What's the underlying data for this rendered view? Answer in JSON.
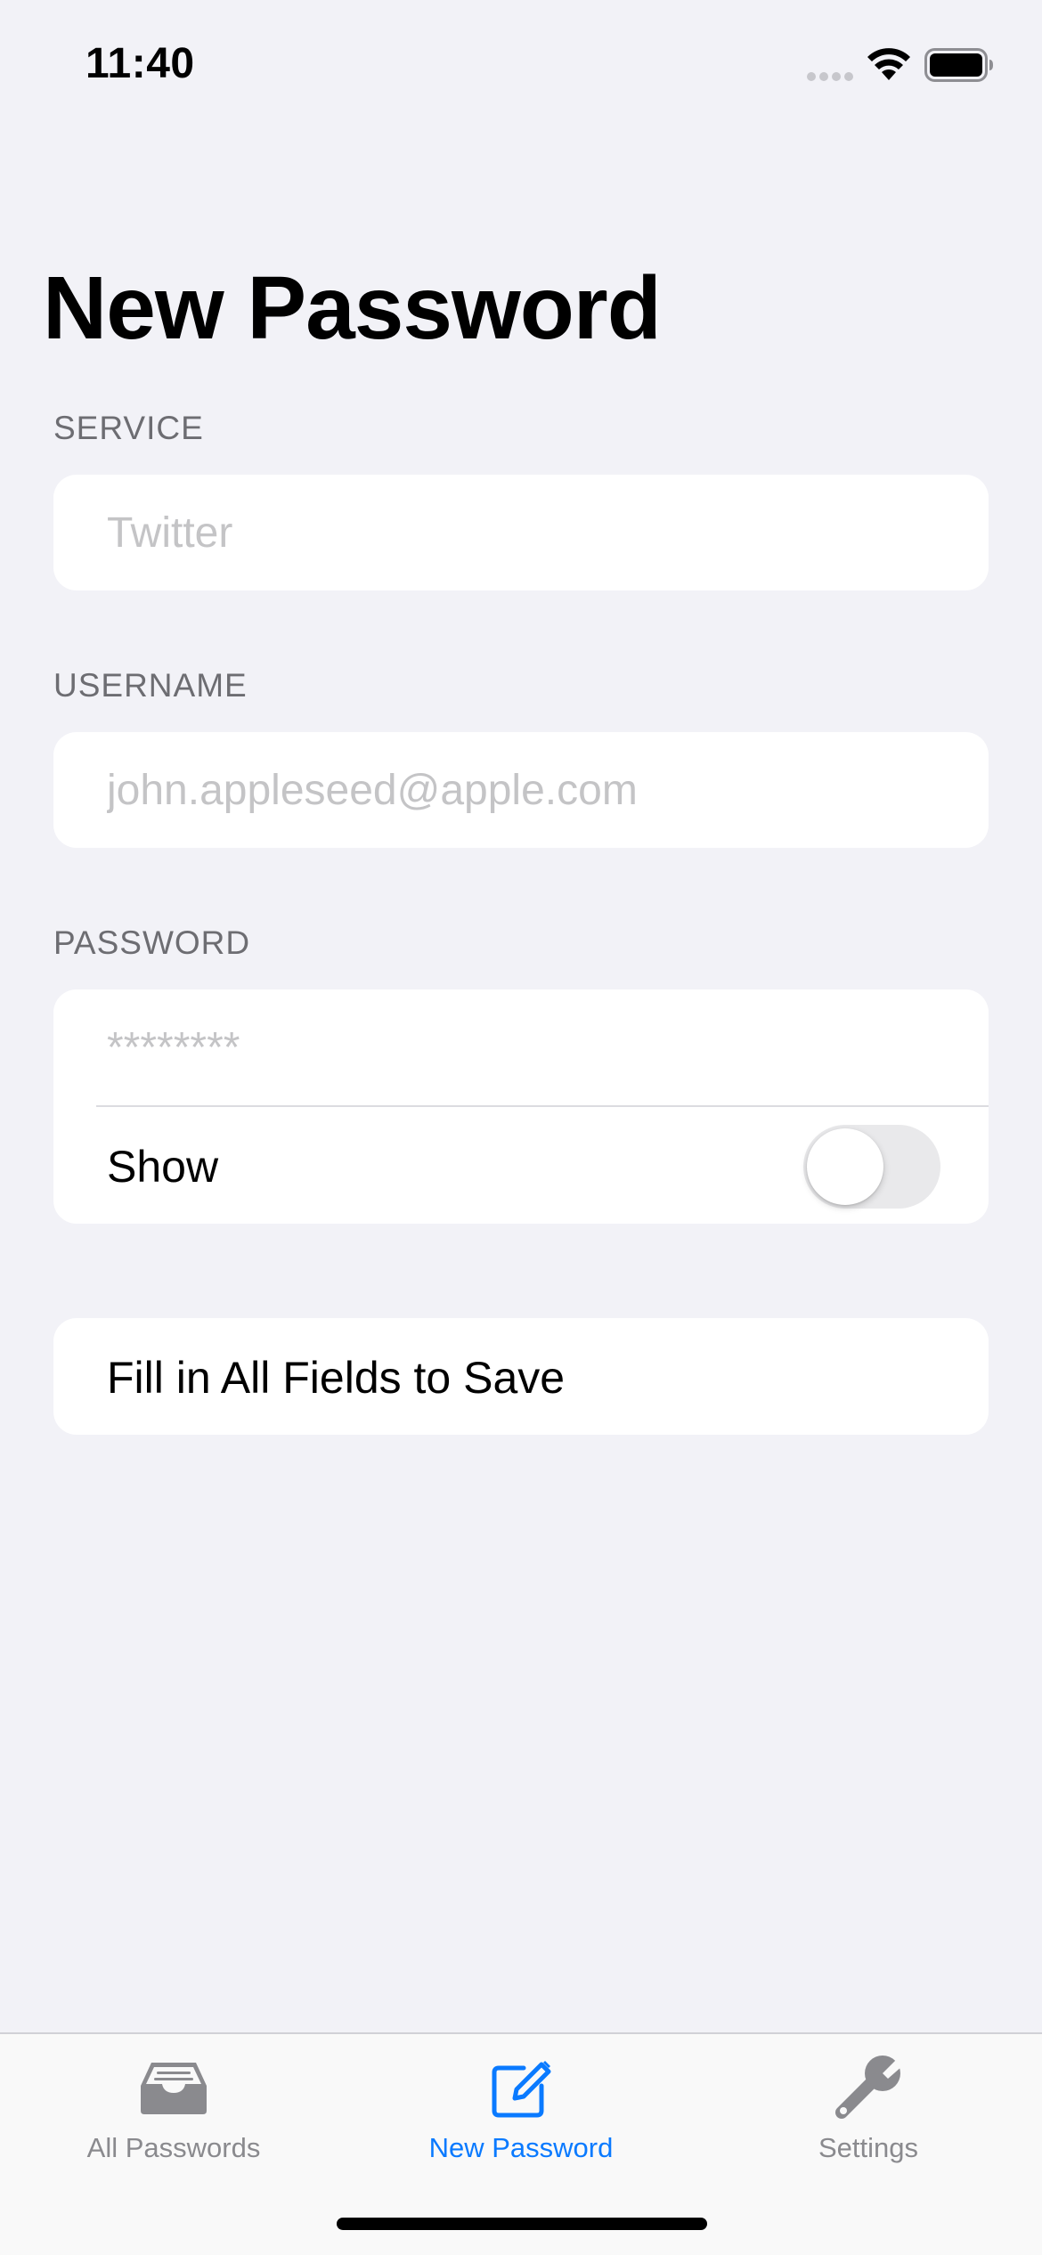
{
  "status_bar": {
    "time": "11:40"
  },
  "page": {
    "title": "New Password"
  },
  "form": {
    "service": {
      "label": "SERVICE",
      "placeholder": "Twitter",
      "value": ""
    },
    "username": {
      "label": "USERNAME",
      "placeholder": "john.appleseed@apple.com",
      "value": ""
    },
    "password": {
      "label": "PASSWORD",
      "placeholder": "********",
      "value": ""
    },
    "show_toggle": {
      "label": "Show",
      "on": false
    },
    "save_button": {
      "label": "Fill in All Fields to Save",
      "enabled": false
    }
  },
  "tab_bar": {
    "tabs": [
      {
        "label": "All Passwords",
        "icon": "tray-icon",
        "active": false
      },
      {
        "label": "New Password",
        "icon": "square-pencil-icon",
        "active": true
      },
      {
        "label": "Settings",
        "icon": "wrench-icon",
        "active": false
      }
    ]
  },
  "colors": {
    "accent": "#0a7aff",
    "inactive": "#8a8a8e",
    "background": "#f2f2f7"
  }
}
